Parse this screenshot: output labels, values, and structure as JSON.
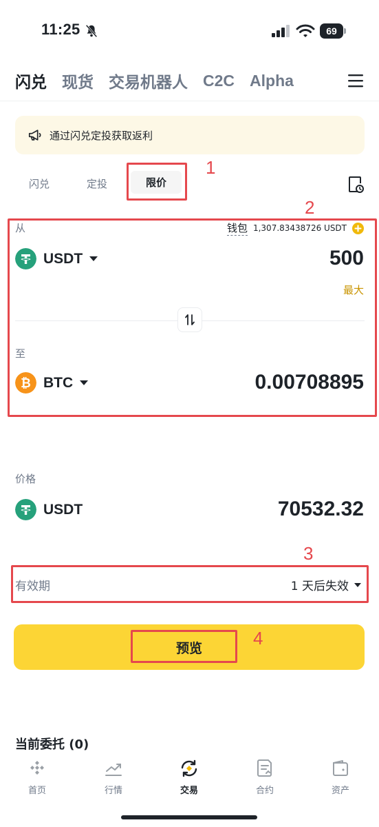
{
  "status_bar": {
    "time": "11:25",
    "battery": "69"
  },
  "top_tabs": [
    {
      "label": "闪兑",
      "active": true
    },
    {
      "label": "现货",
      "active": false
    },
    {
      "label": "交易机器人",
      "active": false
    },
    {
      "label": "C2C",
      "active": false
    },
    {
      "label": "Alpha",
      "active": false
    }
  ],
  "banner": {
    "text": "通过闪兑定投获取返利"
  },
  "sub_tabs": [
    {
      "label": "闪兑",
      "active": false
    },
    {
      "label": "定投",
      "active": false
    },
    {
      "label": "限价",
      "active": true
    }
  ],
  "from": {
    "label": "从",
    "wallet_label": "钱包",
    "wallet_balance": "1,307.83438726 USDT",
    "coin": "USDT",
    "amount": "500",
    "max_label": "最大"
  },
  "to": {
    "label": "至",
    "coin": "BTC",
    "amount": "0.00708895"
  },
  "price": {
    "label": "价格",
    "coin": "USDT",
    "value": "70532.32"
  },
  "validity": {
    "label": "有效期",
    "value": "1 天后失效"
  },
  "preview_button": {
    "label": "预览"
  },
  "orders": {
    "title": "当前委托 (0)"
  },
  "annotations": [
    "1",
    "2",
    "3",
    "4"
  ],
  "bottom_nav": [
    {
      "label": "首页",
      "icon": "home-icon",
      "active": false
    },
    {
      "label": "行情",
      "icon": "markets-icon",
      "active": false
    },
    {
      "label": "交易",
      "icon": "trade-icon",
      "active": true
    },
    {
      "label": "合约",
      "icon": "futures-icon",
      "active": false
    },
    {
      "label": "资产",
      "icon": "wallet-icon",
      "active": false
    }
  ],
  "colors": {
    "accent_yellow": "#fcd535",
    "max_gold": "#c99400",
    "annotation_red": "#e5484d",
    "usdt_green": "#26a17b",
    "btc_orange": "#f7931a"
  }
}
